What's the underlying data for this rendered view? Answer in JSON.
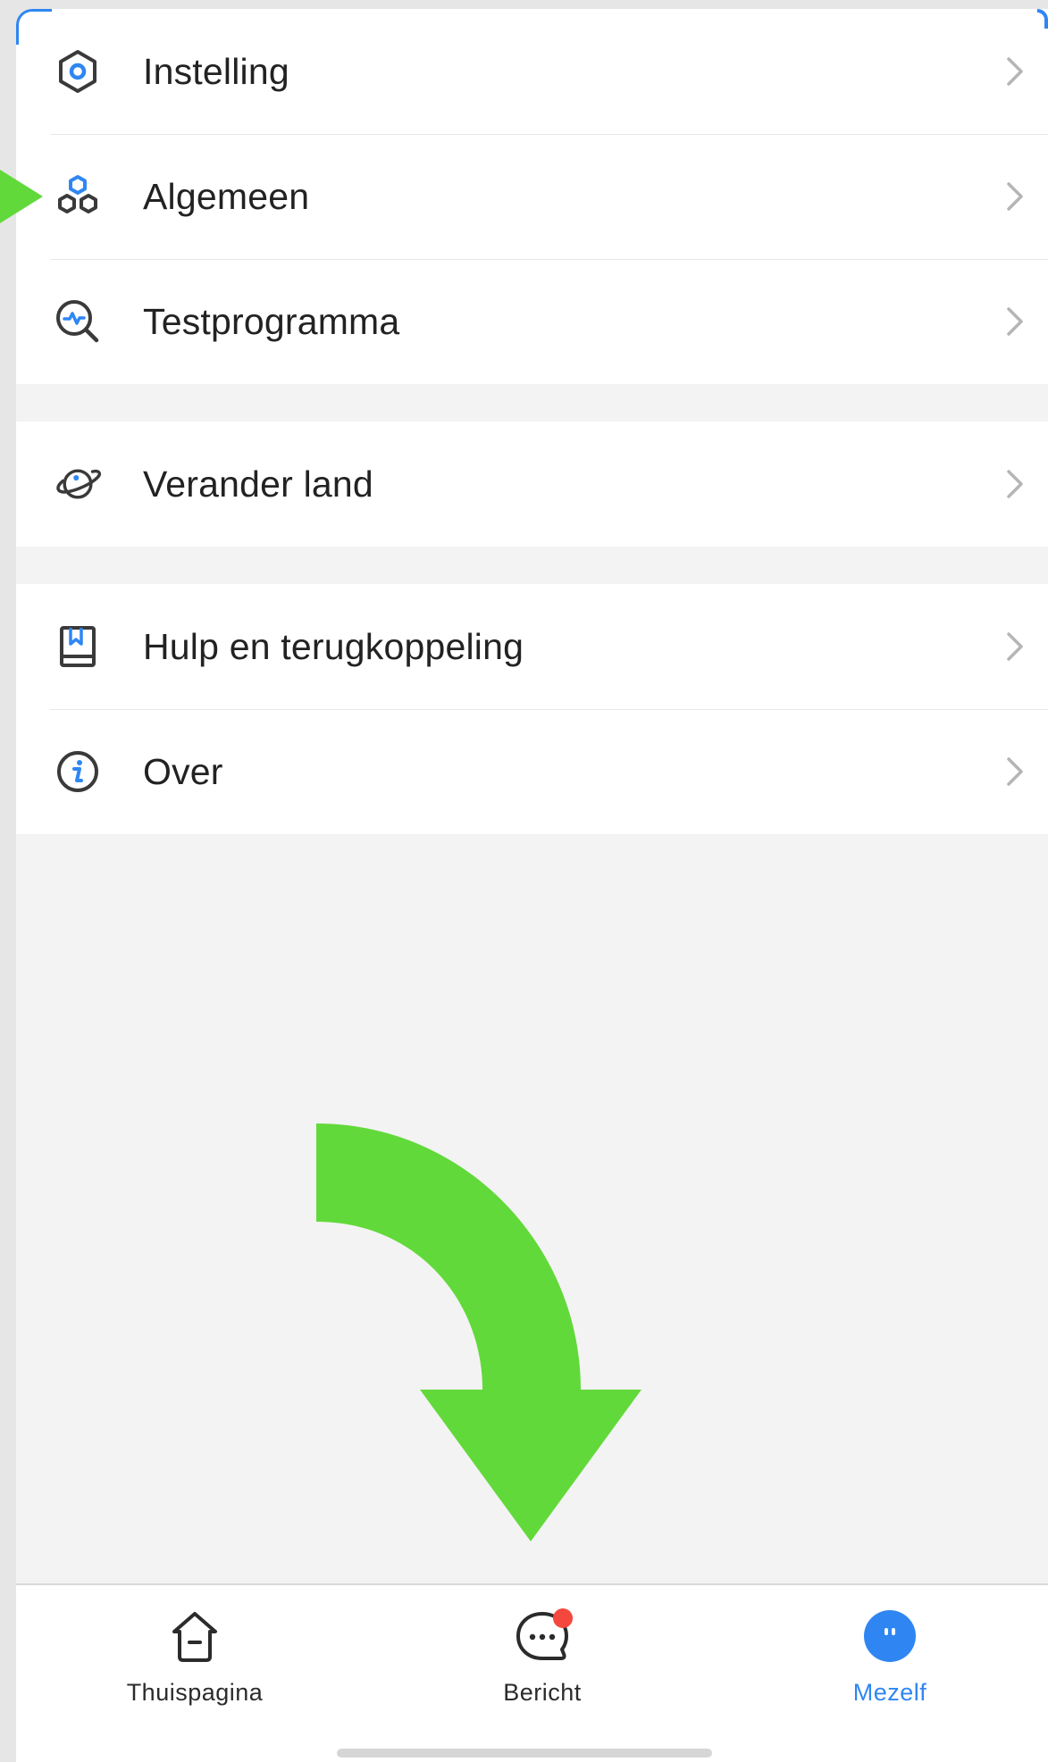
{
  "menu_groups": [
    {
      "items": [
        {
          "label": "Instelling",
          "icon": "settings-hexagon-icon"
        },
        {
          "label": "Algemeen",
          "icon": "general-hexagons-icon"
        },
        {
          "label": "Testprogramma",
          "icon": "test-magnifier-icon"
        }
      ]
    },
    {
      "items": [
        {
          "label": "Verander land",
          "icon": "planet-icon"
        }
      ]
    },
    {
      "items": [
        {
          "label": "Hulp en terugkoppeling",
          "icon": "book-icon"
        },
        {
          "label": "Over",
          "icon": "info-icon"
        }
      ]
    }
  ],
  "tabbar": {
    "tabs": [
      {
        "label": "Thuispagina",
        "icon": "home-icon",
        "active": false
      },
      {
        "label": "Bericht",
        "icon": "chat-icon",
        "active": false,
        "badge": true
      },
      {
        "label": "Mezelf",
        "icon": "profile-icon",
        "active": true
      }
    ]
  },
  "colors": {
    "accent": "#2f86f2",
    "annotation_arrow": "#62d93a",
    "badge": "#f4473d",
    "background": "#f3f3f3",
    "text": "#222222"
  }
}
